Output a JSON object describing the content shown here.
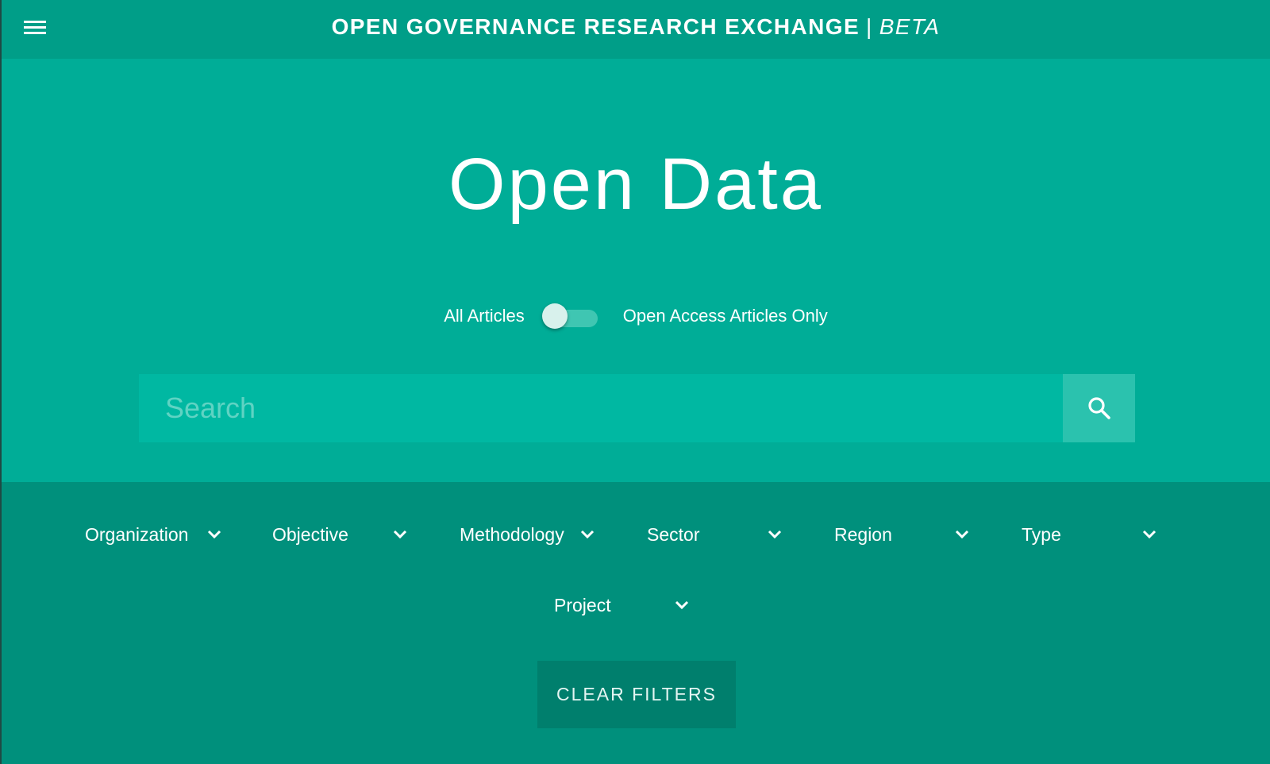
{
  "header": {
    "title": "OPEN GOVERNANCE RESEARCH EXCHANGE",
    "separator": "|",
    "badge": "BETA",
    "menu_icon": "hamburger-menu-icon"
  },
  "hero": {
    "title": "Open Data",
    "toggle": {
      "left_label": "All Articles",
      "right_label": "Open Access Articles Only",
      "state": "off"
    },
    "search": {
      "placeholder": "Search",
      "value": "",
      "button_icon": "search-icon"
    }
  },
  "filters": {
    "items": [
      {
        "label": "Organization"
      },
      {
        "label": "Objective"
      },
      {
        "label": "Methodology"
      },
      {
        "label": "Sector"
      },
      {
        "label": "Region"
      },
      {
        "label": "Type"
      },
      {
        "label": "Project"
      }
    ],
    "dropdown_icon": "chevron-down-icon",
    "clear_label": "CLEAR FILTERS"
  },
  "colors": {
    "header_bg": "#009e88",
    "hero_bg": "#00ad97",
    "filters_bg": "#00907c",
    "search_bg": "#00b8a2",
    "search_button_bg": "#2bc2ae",
    "clear_button_bg": "#007f6d"
  }
}
